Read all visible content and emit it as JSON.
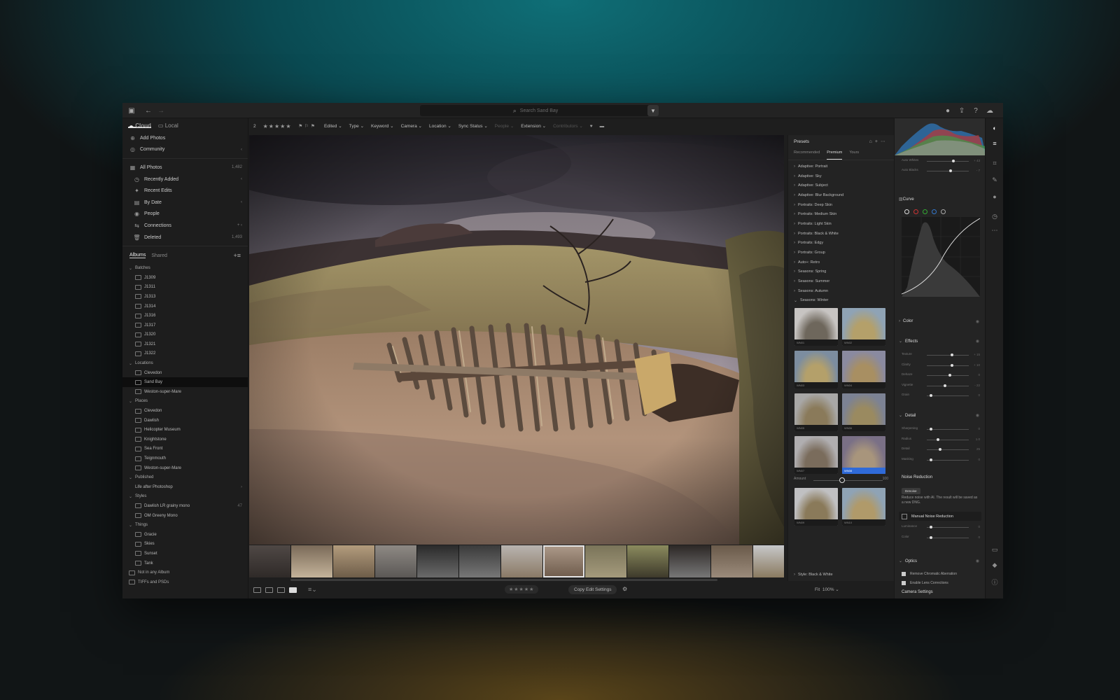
{
  "titlebar": {
    "search_placeholder": "Search Sand Bay"
  },
  "sidebar": {
    "tabs": [
      "Cloud",
      "Local"
    ],
    "top": [
      {
        "label": "Add Photos",
        "icon": "plus-icon"
      },
      {
        "label": "Community",
        "icon": "community-icon",
        "right": "‹"
      }
    ],
    "photos": [
      {
        "label": "All Photos",
        "right": "1,482"
      },
      {
        "label": "Recently Added",
        "right": "‹"
      },
      {
        "label": "Recent Edits",
        "right": ""
      },
      {
        "label": "By Date",
        "right": "‹"
      },
      {
        "label": "People",
        "right": ""
      },
      {
        "label": "Connections",
        "right": "+ ‹"
      },
      {
        "label": "Deleted",
        "right": "1,493"
      }
    ],
    "album_tabs": [
      "Albums",
      "Shared"
    ],
    "albums": [
      {
        "type": "grp",
        "label": "Batches"
      },
      {
        "type": "it",
        "label": "J1309"
      },
      {
        "type": "it",
        "label": "J1311"
      },
      {
        "type": "it",
        "label": "J1313"
      },
      {
        "type": "it",
        "label": "J1314"
      },
      {
        "type": "it",
        "label": "J1316"
      },
      {
        "type": "it",
        "label": "J1317"
      },
      {
        "type": "it",
        "label": "J1320"
      },
      {
        "type": "it",
        "label": "J1321"
      },
      {
        "type": "it",
        "label": "J1322"
      },
      {
        "type": "grp",
        "label": "Locations"
      },
      {
        "type": "it",
        "label": "Clevedon"
      },
      {
        "type": "it",
        "label": "Sand Bay",
        "sel": true
      },
      {
        "type": "it",
        "label": "Weston-super-Mare"
      },
      {
        "type": "grp",
        "label": "Places"
      },
      {
        "type": "it",
        "label": "Clevedon"
      },
      {
        "type": "it",
        "label": "Dawlish"
      },
      {
        "type": "it",
        "label": "Helicopter Museum"
      },
      {
        "type": "it",
        "label": "Knightstone"
      },
      {
        "type": "it",
        "label": "Sea Front"
      },
      {
        "type": "it",
        "label": "Teignmouth"
      },
      {
        "type": "it",
        "label": "Weston-super-Mare"
      },
      {
        "type": "grp",
        "label": "Published"
      },
      {
        "type": "it",
        "label": "Life after Photoshop",
        "noicon": true,
        "right": "›"
      },
      {
        "type": "grp",
        "label": "Styles"
      },
      {
        "type": "it",
        "label": "Dawlish LR grainy mono",
        "right": "47"
      },
      {
        "type": "it",
        "label": "OM Greeny Mono"
      },
      {
        "type": "grp",
        "label": "Things"
      },
      {
        "type": "it",
        "label": "Gracie"
      },
      {
        "type": "it",
        "label": "Skies"
      },
      {
        "type": "it",
        "label": "Sunset"
      },
      {
        "type": "it",
        "label": "Tank"
      },
      {
        "type": "top",
        "label": "Not in any Album"
      },
      {
        "type": "top",
        "label": "TIFFs and PSDs"
      }
    ]
  },
  "toolbar": {
    "count": "2",
    "stars": "★★★★★",
    "filters": [
      "Edited",
      "Type",
      "Keyword",
      "Camera",
      "Location",
      "Sync Status",
      "People",
      "Extension",
      "Contributors"
    ]
  },
  "presets": {
    "title": "Presets",
    "tabs": [
      "Recommended",
      "Premium",
      "Yours"
    ],
    "groups": [
      "Adaptive: Portrait",
      "Adaptive: Sky",
      "Adaptive: Subject",
      "Adaptive: Blur Background",
      "Portraits: Deep Skin",
      "Portraits: Medium Skin",
      "Portraits: Light Skin",
      "Portraits: Black & White",
      "Portraits: Edgy",
      "Portraits: Group",
      "Auto+: Retro",
      "Seasons: Spring",
      "Seasons: Summer",
      "Seasons: Autumn",
      "Seasons: Winter"
    ],
    "thumbs": [
      "WN01",
      "WN02",
      "WN03",
      "WN04",
      "WN05",
      "WN06",
      "WN07",
      "WN08",
      "WN09",
      "WN10"
    ],
    "amount_label": "Amount",
    "amount_value": "100",
    "footer_group": "Style: Black & White"
  },
  "edit": {
    "top_sliders": [
      {
        "label": "Auto Whites",
        "value": "+ 43"
      },
      {
        "label": "Auto Blacks",
        "value": "- 7"
      }
    ],
    "curve_label": "Curve",
    "color_label": "Color",
    "effects_label": "Effects",
    "effects": [
      {
        "label": "Texture",
        "value": "+ 15"
      },
      {
        "label": "Clarity",
        "value": "+ 10"
      },
      {
        "label": "Dehaze",
        "value": "0"
      },
      {
        "label": "Vignette",
        "value": "- 22"
      },
      {
        "label": "Grain",
        "value": "0"
      }
    ],
    "detail_label": "Detail",
    "detail": [
      {
        "label": "Sharpening",
        "value": "0"
      },
      {
        "label": "Radius",
        "value": "1.0"
      },
      {
        "label": "Detail",
        "value": "25"
      },
      {
        "label": "Masking",
        "value": "0"
      }
    ],
    "nr_title": "Noise Reduction",
    "denoise_label": "Denoise",
    "nr_text": "Reduce noise with AI. The result will be saved as a new DNG.",
    "manual_label": "Manual Noise Reduction",
    "nr_sliders": [
      {
        "label": "Luminance",
        "value": "0"
      },
      {
        "label": "Color",
        "value": "0"
      }
    ],
    "optics_label": "Optics",
    "optics": [
      "Remove Chromatic Aberration",
      "Enable Lens Corrections"
    ],
    "camera_settings": "Camera Settings"
  },
  "bottom": {
    "copy_label": "Copy Edit Settings",
    "stars": "★★★★★",
    "fit": "Fit",
    "zoom": "100%"
  }
}
